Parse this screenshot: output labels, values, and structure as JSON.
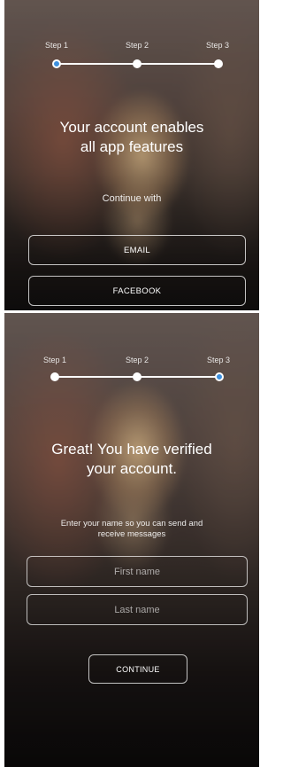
{
  "screens": [
    {
      "steps": [
        "Step 1",
        "Step 2",
        "Step 3"
      ],
      "active_step": 1,
      "headline": [
        "Your account enables",
        "all app features"
      ],
      "subtext": "Continue with",
      "buttons": {
        "email": "EMAIL",
        "facebook": "FACEBOOK"
      }
    },
    {
      "steps": [
        "Step 1",
        "Step 2",
        "Step 3"
      ],
      "active_step": 3,
      "headline": [
        "Great! You have verified",
        "your account."
      ],
      "subtext": [
        "Enter your name so you can send and",
        "receive messages"
      ],
      "first_name": {
        "placeholder": "First name",
        "value": ""
      },
      "last_name": {
        "placeholder": "Last name",
        "value": ""
      },
      "continue_label": "CONTINUE"
    }
  ],
  "colors": {
    "active_step": "#3c8fde",
    "text": "#ffffff"
  }
}
